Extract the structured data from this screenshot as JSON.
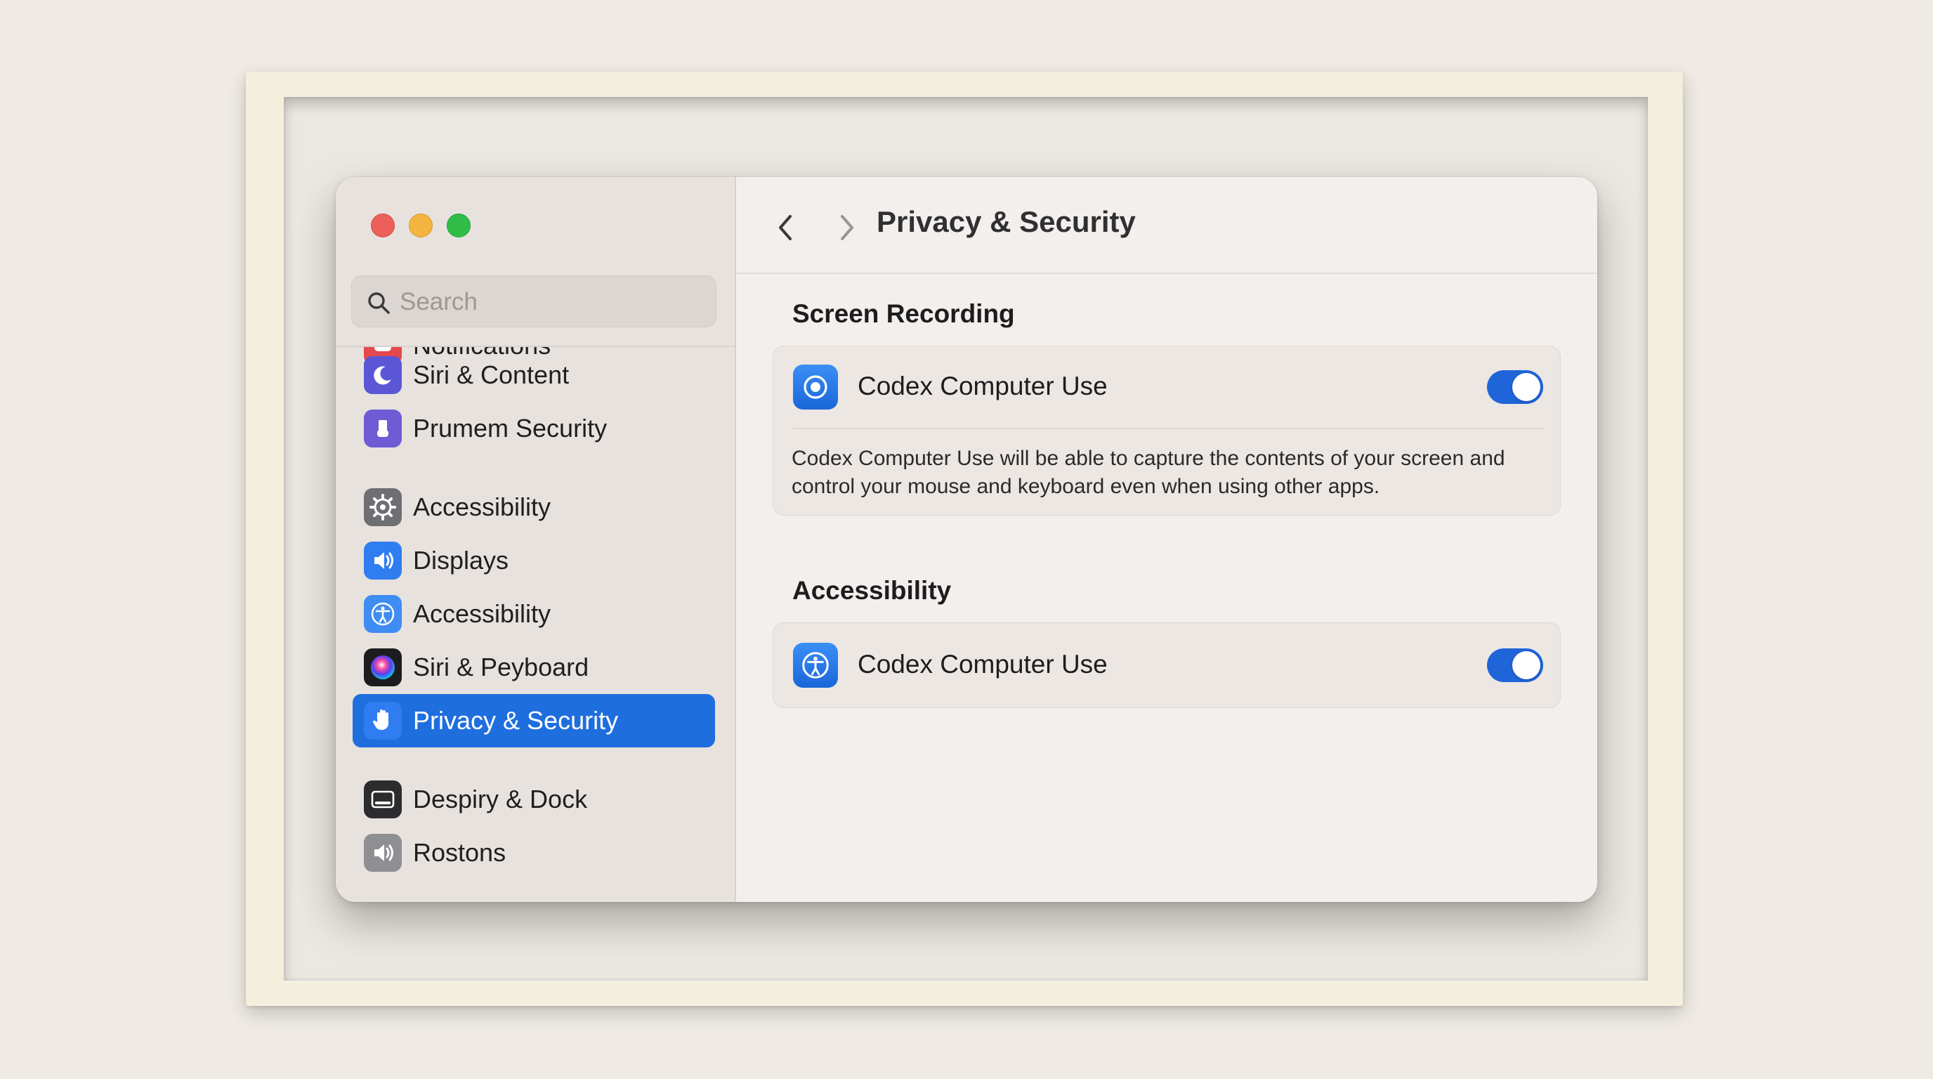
{
  "window": {
    "title": "Privacy & Security"
  },
  "sidebar": {
    "search": {
      "placeholder": "Search",
      "value": ""
    },
    "items": [
      {
        "label": "Notifications",
        "icon": "notifications-icon",
        "color": "#e5484d"
      },
      {
        "label": "Siri & Content",
        "icon": "moon-icon",
        "color": "#5b56d6"
      },
      {
        "label": "Prumem Security",
        "icon": "hand-raised-icon",
        "color": "#6f5bd3"
      },
      {
        "label": "Accessibility",
        "icon": "gear-icon",
        "color": "#6e6e73"
      },
      {
        "label": "Displays",
        "icon": "speaker-icon",
        "color": "#2f7df0"
      },
      {
        "label": "Accessibility",
        "icon": "accessibility-icon",
        "color": "#3f8cf2"
      },
      {
        "label": "Siri & Peyboard",
        "icon": "siri-icon",
        "color": "#1d1d1f"
      },
      {
        "label": "Privacy & Security",
        "icon": "hand-icon",
        "color": "#2f7df0",
        "selected": true
      },
      {
        "label": "Despiry & Dock",
        "icon": "dock-icon",
        "color": "#2c2c2e"
      },
      {
        "label": "Rostons",
        "icon": "speaker-icon",
        "color": "#8e8e93"
      }
    ]
  },
  "main": {
    "sections": [
      {
        "title": "Screen Recording",
        "app": "Codex Computer Use",
        "enabled": true,
        "description": "Codex Computer Use will be able to capture the contents of your screen and control your mouse and keyboard even when using other apps."
      },
      {
        "title": "Accessibility",
        "app": "Codex Computer Use",
        "enabled": true
      }
    ]
  },
  "colors": {
    "accent": "#1f6ede",
    "toggle_on": "#2064d9"
  }
}
